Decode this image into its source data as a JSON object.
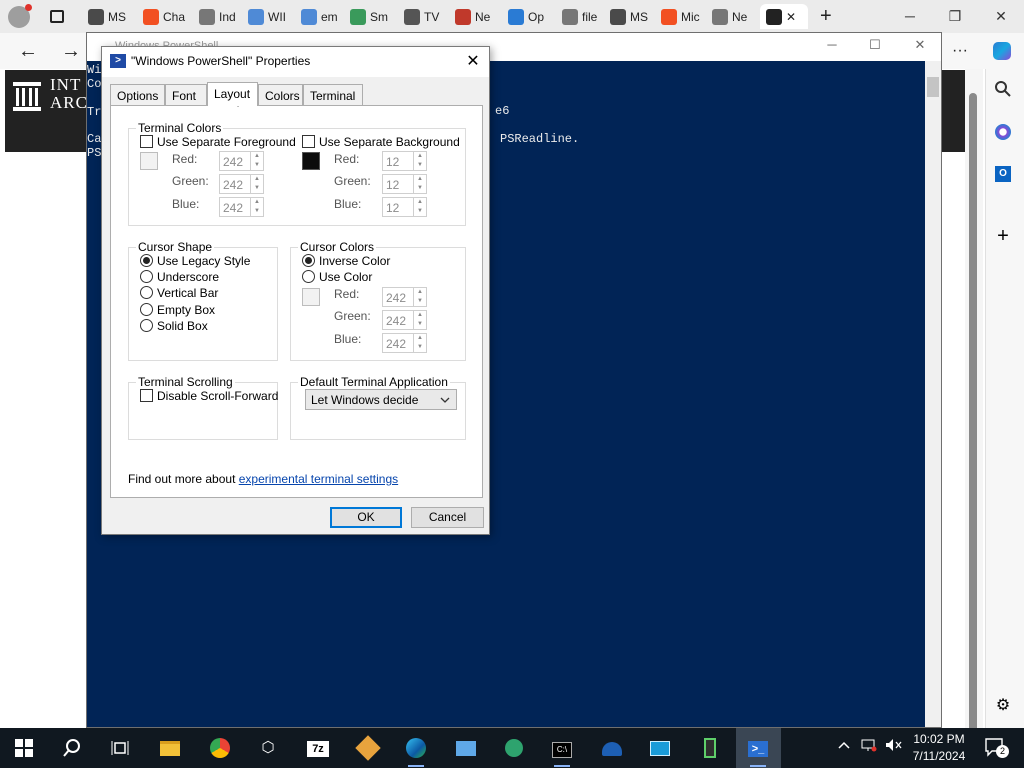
{
  "browser": {
    "tabs": [
      {
        "label": "MS",
        "color": "#4a4a4a"
      },
      {
        "label": "Cha",
        "color": "#f25022"
      },
      {
        "label": "Ind",
        "color": "#777777"
      },
      {
        "label": "WII",
        "color": "#4f8ad6"
      },
      {
        "label": "em",
        "color": "#4f8ad6"
      },
      {
        "label": "Sm",
        "color": "#3a9a5b"
      },
      {
        "label": "TV",
        "color": "#555555"
      },
      {
        "label": "Ne",
        "color": "#c0392b"
      },
      {
        "label": "Op",
        "color": "#2a7bd4"
      },
      {
        "label": "file",
        "color": "#777777"
      },
      {
        "label": "MS",
        "color": "#4a4a4a"
      },
      {
        "label": "Mic",
        "color": "#f25022"
      },
      {
        "label": "Ne",
        "color": "#777777"
      }
    ],
    "new_tab": "+",
    "minimize": "─",
    "restore": "❐",
    "close": "✕",
    "back": "←",
    "forward": "→",
    "more": "···"
  },
  "archive": {
    "name_line1": "INT",
    "name_line2": "ARC"
  },
  "powershell": {
    "title": "Windows PowerShell",
    "lines": [
      "Wi",
      "Co",
      "Tr",
      "Ca",
      "PS"
    ],
    "fragment_e6": "e6",
    "fragment_psreadline": "PSReadline.",
    "minimize": "─",
    "maximize": "☐",
    "close": "✕"
  },
  "dialog": {
    "title": "\"Windows PowerShell\" Properties",
    "close": "✕",
    "tabs": [
      "Options",
      "Font",
      "Layout",
      "Colors",
      "Terminal"
    ],
    "selected_tab": "Layout",
    "terminal_colors": {
      "label": "Terminal Colors",
      "fg_checkbox": "Use Separate Foreground",
      "bg_checkbox": "Use Separate Background",
      "fg_swatch": "#f2f2f2",
      "bg_swatch": "#0c0c0c",
      "red_label": "Red:",
      "green_label": "Green:",
      "blue_label": "Blue:",
      "fg_red": "242",
      "fg_green": "242",
      "fg_blue": "242",
      "bg_red": "12",
      "bg_green": "12",
      "bg_blue": "12"
    },
    "cursor_shape": {
      "label": "Cursor Shape",
      "options": [
        "Use Legacy Style",
        "Underscore",
        "Vertical Bar",
        "Empty Box",
        "Solid Box"
      ],
      "selected": "Use Legacy Style"
    },
    "cursor_colors": {
      "label": "Cursor Colors",
      "inverse": "Inverse Color",
      "use_color": "Use Color",
      "selected": "Inverse Color",
      "swatch": "#f2f2f2",
      "red_label": "Red:",
      "green_label": "Green:",
      "blue_label": "Blue:",
      "red": "242",
      "green": "242",
      "blue": "242"
    },
    "terminal_scrolling": {
      "label": "Terminal Scrolling",
      "checkbox": "Disable Scroll-Forward"
    },
    "default_terminal": {
      "label": "Default Terminal Application",
      "selected": "Let Windows decide"
    },
    "find_more_text": "Find out more about",
    "find_more_link": "experimental terminal settings",
    "ok": "OK",
    "cancel": "Cancel"
  },
  "taskbar": {
    "time": "10:02 PM",
    "date": "7/11/2024",
    "notification_count": "2"
  }
}
